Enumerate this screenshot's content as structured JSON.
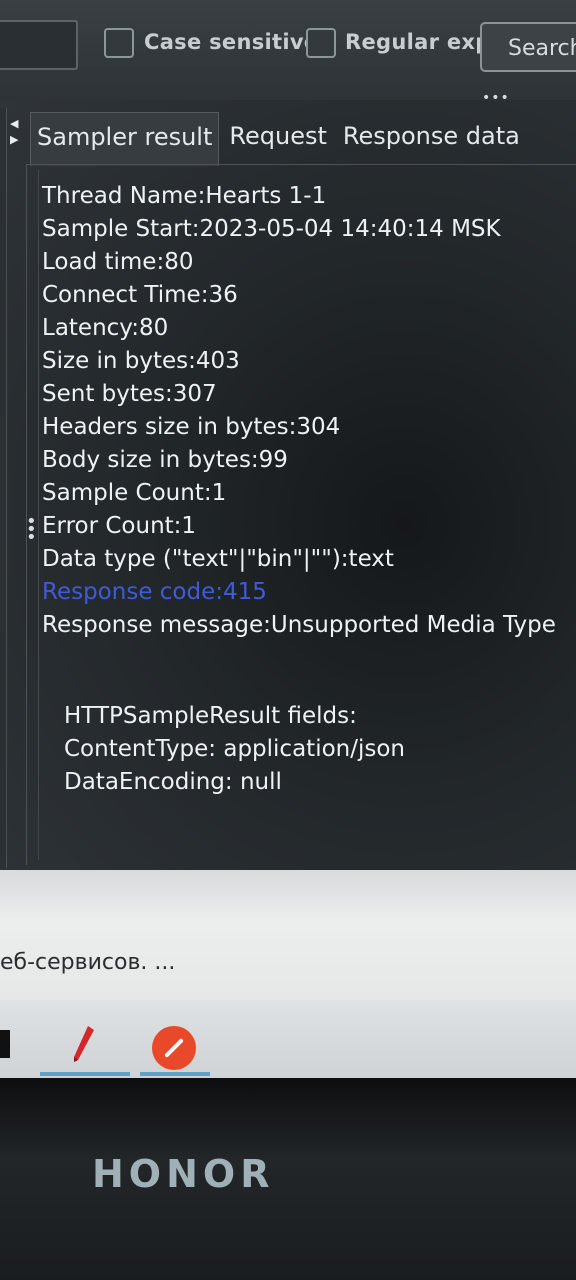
{
  "toolbar": {
    "search_value": "",
    "case_sensitive_label": "Case sensitive",
    "regex_label": "Regular exp.",
    "search_button_label": "Search",
    "more_label": "•••"
  },
  "tabs": [
    "Sampler result",
    "Request",
    "Response data"
  ],
  "result_lines": [
    "Thread Name:Hearts 1-1",
    "Sample Start:2023-05-04 14:40:14 MSK",
    "Load time:80",
    "Connect Time:36",
    "Latency:80",
    "Size in bytes:403",
    "Sent bytes:307",
    "Headers size in bytes:304",
    "Body size in bytes:99",
    "Sample Count:1",
    "Error Count:1",
    "Data type (\"text\"|\"bin\"|\"\"):text",
    "Response code:415",
    "Response message:Unsupported Media Type"
  ],
  "sample_fields": [
    "HTTPSampleResult fields:",
    "ContentType: application/json",
    "DataEncoding: null"
  ],
  "colors": {
    "response_code": "#3f5bd8",
    "taskbar_icon_red": "#e8492a"
  },
  "page_snippet": "еб-сервисов. ...",
  "brand": "HONOR"
}
